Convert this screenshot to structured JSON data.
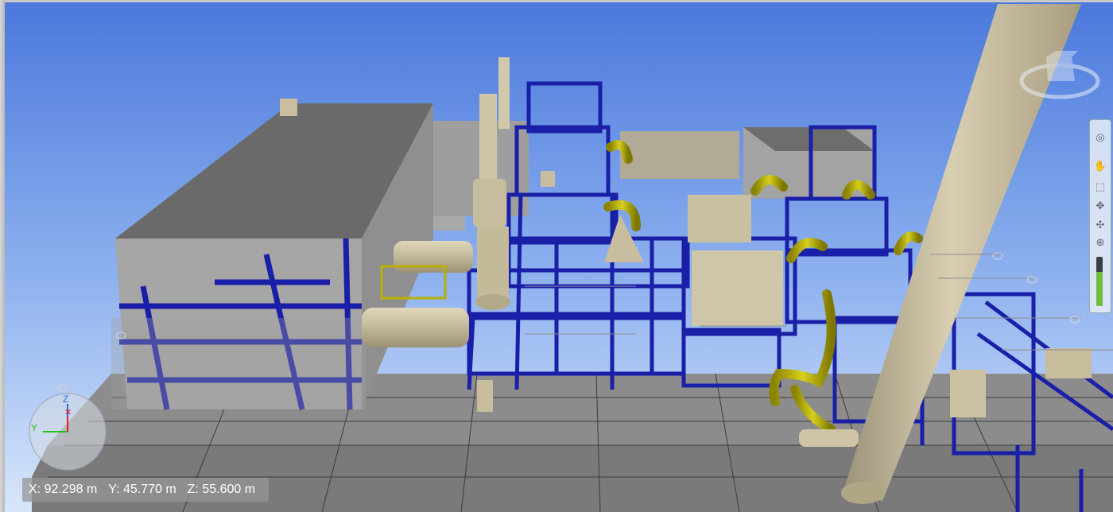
{
  "viewer": {
    "sky_top_color": "#4f7fe0",
    "sky_bottom_color": "#d6e6fb",
    "ground_color": "#8a8a8a",
    "steel_color": "#1c1f9e",
    "equipment_color": "#cfc5a8",
    "pipe_color": "#b7b000"
  },
  "coordinates": {
    "x": "X: 92.298 m",
    "y": "Y: 45.770 m",
    "z": "Z: 55.600 m"
  },
  "compass": {
    "z_axis": "Z",
    "y_axis": "Y"
  },
  "nav_toolbar": {
    "tools": [
      {
        "name": "steering-wheel-icon",
        "glyph": "◎"
      },
      {
        "name": "pan-hand-icon",
        "glyph": "✋"
      },
      {
        "name": "zoom-window-icon",
        "glyph": "⬚"
      },
      {
        "name": "orbit-icon",
        "glyph": "✥"
      },
      {
        "name": "look-icon",
        "glyph": "✣"
      },
      {
        "name": "walk-icon",
        "glyph": "⊕"
      },
      {
        "name": "center-icon",
        "glyph": "⊙"
      }
    ],
    "zoom_level": 0.7
  }
}
